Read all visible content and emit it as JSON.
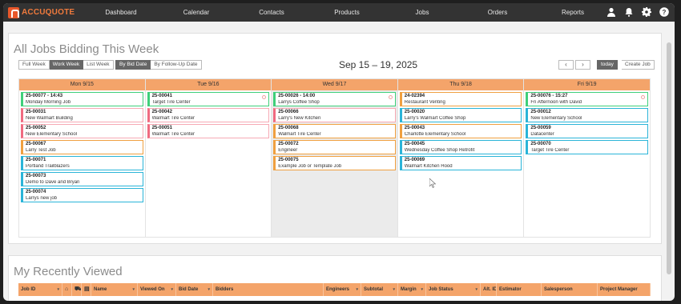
{
  "app": {
    "logo_text": "ACCUQUOTE"
  },
  "nav": {
    "items": [
      "Dashboard",
      "Calendar",
      "Contacts",
      "Products",
      "Jobs",
      "Orders",
      "Reports"
    ]
  },
  "nav_icons": [
    "user-icon",
    "bell-icon",
    "gear-icon",
    "help-icon"
  ],
  "bidding": {
    "title": "All Jobs Bidding This Week",
    "view_buttons": [
      "Full Week",
      "Work Week",
      "List Week"
    ],
    "active_view": "Work Week",
    "sort_buttons": [
      "By Bid Date",
      "By Follow-Up Date"
    ],
    "active_sort": "By Bid Date",
    "date_range": "Sep 15 – 19, 2025",
    "prev": "‹",
    "next": "›",
    "today": "today",
    "create": "Create Job",
    "days": [
      {
        "label": "Mon 9/15",
        "jobs": [
          {
            "id": "25-00077 - 14:43",
            "name": "Monday Morning Job",
            "color": "green",
            "flag": false
          },
          {
            "id": "25-00031",
            "name": "New Walmart Building",
            "color": "pink",
            "flag": false
          },
          {
            "id": "25-00052",
            "name": "New Elementary School",
            "color": "pink",
            "flag": false
          },
          {
            "id": "25-00067",
            "name": "Larry Test Job",
            "color": "orange",
            "flag": false
          },
          {
            "id": "25-00071",
            "name": "Portland Trailblazers",
            "color": "blue",
            "flag": false
          },
          {
            "id": "25-00073",
            "name": "Demo to Dave and Bryan",
            "color": "blue",
            "flag": false
          },
          {
            "id": "25-00074",
            "name": "Larrys new job",
            "color": "blue",
            "flag": false
          }
        ]
      },
      {
        "label": "Tue 9/16",
        "jobs": [
          {
            "id": "25-00041",
            "name": "Target Tire Center",
            "color": "green",
            "flag": true
          },
          {
            "id": "25-00042",
            "name": "Walmart Tire Center",
            "color": "pink",
            "flag": false
          },
          {
            "id": "25-00051",
            "name": "Walmart Tire Center",
            "color": "pink",
            "flag": false
          }
        ]
      },
      {
        "label": "Wed 9/17",
        "jobs": [
          {
            "id": "25-00026 - 14:00",
            "name": "Larrys Coffee Shop",
            "color": "green",
            "flag": true
          },
          {
            "id": "25-00066",
            "name": "Larry's New Kitchen",
            "color": "pink",
            "flag": false
          },
          {
            "id": "25-00068",
            "name": "Walmart Tire Center",
            "color": "orange",
            "flag": false
          },
          {
            "id": "25-00072",
            "name": "Engineer",
            "color": "orange",
            "flag": false
          },
          {
            "id": "25-00075",
            "name": "Example Job or Template Job",
            "color": "orange",
            "flag": false
          }
        ]
      },
      {
        "label": "Thu 9/18",
        "jobs": [
          {
            "id": "24-02394",
            "name": "Restaurant Venting",
            "color": "orange",
            "flag": false
          },
          {
            "id": "25-00020",
            "name": "Larry's Walmart Coffee Shop",
            "color": "blue",
            "flag": false
          },
          {
            "id": "25-00043",
            "name": "Charlotte Elementary School",
            "color": "orange",
            "flag": false
          },
          {
            "id": "25-00045",
            "name": "Wednesday Coffee Shop Retrofit",
            "color": "blue",
            "flag": false
          },
          {
            "id": "25-00069",
            "name": "Walmart Kitchen Hood",
            "color": "blue",
            "flag": false
          }
        ]
      },
      {
        "label": "Fri 9/19",
        "jobs": [
          {
            "id": "25-00076 - 15:27",
            "name": "Fri Afternoon with David",
            "color": "green",
            "flag": true
          },
          {
            "id": "25-00012",
            "name": "New Elementary School",
            "color": "blue",
            "flag": false
          },
          {
            "id": "25-00059",
            "name": "Datacenter",
            "color": "blue",
            "flag": false
          },
          {
            "id": "25-00070",
            "name": "Target Tire Center",
            "color": "blue",
            "flag": false
          }
        ]
      }
    ]
  },
  "recent": {
    "title": "My Recently Viewed",
    "columns": [
      "Job ID",
      "",
      "",
      "",
      "Name",
      "Viewed On",
      "Bid Date",
      "Bidders",
      "Engineers",
      "Subtotal",
      "Margin",
      "Job Status",
      "Alt. ID",
      "Estimator",
      "Salesperson",
      "Project Manager"
    ]
  }
}
